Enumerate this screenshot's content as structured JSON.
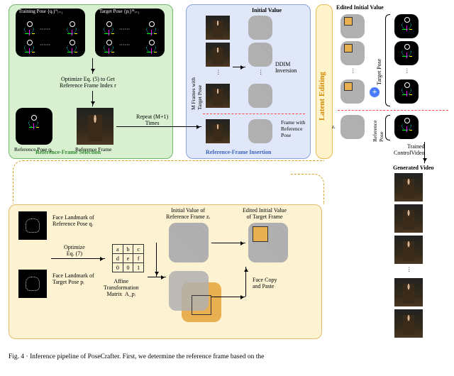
{
  "selection": {
    "title": "Reference-Frame Selection",
    "train_set": "Training Pose {qᵢ}ᴺᵢ₌₁",
    "target_set": "Target Pose {pᵢ}ᴹᵢ₌₁",
    "optimize5": "Optimize Eq. (5) to Get\nReference Frame Index r",
    "ref_pose": "Reference Pose qᵣ",
    "ref_frame": "Reference Frame"
  },
  "insertion": {
    "title": "Reference-Frame Insertion",
    "initial": "Initial Value",
    "ddim": "DDIM\nInversion",
    "m_frames": "M Frames with\nTarget Pose",
    "frame_with_ref": "Frame with\nReference\nPose",
    "repeat": "Repeat (M+1)\nTimes"
  },
  "editing": {
    "title": "Latent Editing",
    "face_ref": "Face Landmark of\nReference Pose qᵣ",
    "face_tgt": "Face Landmark of\nTarget Pose pᵢ",
    "optimize7": "Optimize\nEq. (7)",
    "matrix": "Affine\nTransformation\nMatrix  A_pᵢ",
    "copy": "Face Copy\nand Paste",
    "init_ref": "Initial Value of\nReference Frame zᵣ",
    "edit_tgt": "Edited Initial Value\nof Target Frame",
    "matrix_vals": {
      "a": "a",
      "b": "b",
      "c": "c",
      "d": "d",
      "e": "e",
      "f": "f",
      "g": "0",
      "h": "0",
      "i": "1"
    }
  },
  "rightcol": {
    "edited_initial": "Edited Initial Value",
    "target_pose": "Target Pose",
    "ref_pose": "Reference\nPose",
    "zr": "zᵣ",
    "trained": "Trained\nControlVideo",
    "generated": "Generated Video"
  },
  "caption_prefix": "Fig. 4 · Inference pipeline of PoseCrafter. First, we determine the reference frame based on the"
}
